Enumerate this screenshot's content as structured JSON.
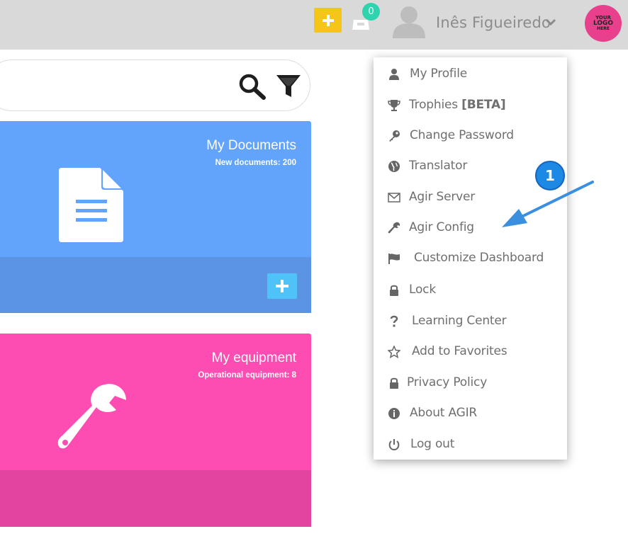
{
  "topbar": {
    "inbox_count": "0",
    "user_name": "Inês Figueiredo",
    "logo_lines": [
      "YOUR",
      "LOGO",
      "HERE"
    ]
  },
  "search": {
    "placeholder": ""
  },
  "tiles": [
    {
      "title": "My Documents",
      "subtitle": "New documents: 200",
      "color": "#62a3fb",
      "icon": "document-icon"
    },
    {
      "title": "My equipment",
      "subtitle": "Operational equipment: 8",
      "color": "#fd4db2",
      "icon": "wrench-icon"
    }
  ],
  "menu": {
    "items": [
      {
        "label": "My Profile",
        "icon": "user-icon"
      },
      {
        "label": "Trophies ",
        "label_bold": "[BETA]",
        "icon": "trophy-icon"
      },
      {
        "label": "Change Password",
        "icon": "key-icon"
      },
      {
        "label": "Translator",
        "icon": "globe-icon"
      },
      {
        "label": "Agir Server",
        "icon": "envelope-icon"
      },
      {
        "label": "Agir Config",
        "icon": "wrench-icon"
      },
      {
        "label": "Customize Dashboard",
        "icon": "flag-icon"
      },
      {
        "label": "Lock",
        "icon": "lock-icon"
      },
      {
        "label": "Learning Center",
        "icon": "question-icon"
      },
      {
        "label": "Add to Favorites",
        "icon": "star-icon"
      },
      {
        "label": "Privacy Policy",
        "icon": "lock-icon"
      },
      {
        "label": "About AGIR",
        "icon": "info-icon"
      },
      {
        "label": "Log out",
        "icon": "power-icon"
      }
    ]
  },
  "annotation": {
    "number": "1",
    "color": "#1e88e5"
  },
  "colors": {
    "topbar": "#d9d9d9",
    "add_button": "#f5c518",
    "badge": "#2fd3ad",
    "logo": "#e8408d"
  }
}
